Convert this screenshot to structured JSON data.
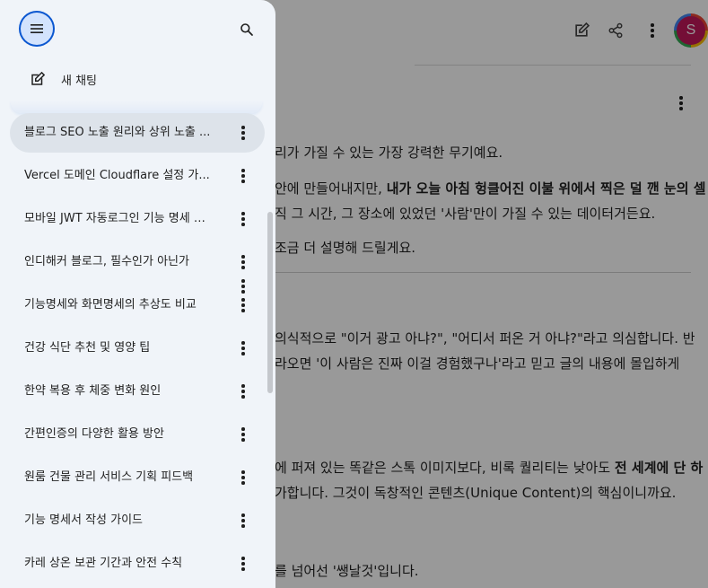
{
  "drawer": {
    "new_chat_label": "새 채팅",
    "chats": [
      {
        "title": "블로그 SEO 노출 원리와 상위 노출 ...",
        "active": true
      },
      {
        "title": "Vercel 도메인 Cloudflare 설정 가..."
      },
      {
        "title": "모바일 JWT 자동로그인 기능 명세 작..."
      },
      {
        "title": "인디해커 블로그, 필수인가 아닌가"
      },
      {
        "title": "기능명세와 화면명세의 추상도 비교"
      },
      {
        "title": "건강 식단 추천 및 영양 팁"
      },
      {
        "title": "한약 복용 후 체중 변화 원인"
      },
      {
        "title": "간편인증의 다양한 활용 방안"
      },
      {
        "title": "원룸 건물 관리 서비스 기획 피드백"
      },
      {
        "title": "기능 명세서 작성 가이드"
      },
      {
        "title": "카레 상온 보관 기간과 안전 수칙"
      }
    ]
  },
  "header": {
    "avatar_initial": "S"
  },
  "conversation": {
    "line1": "리가 가질 수 있는 가장 강력한 무기예요.",
    "line2_normal": "안에 만들어내지만, ",
    "line2_bold": "내가 오늘 아침 헝클어진 이불 위에서 찍은 덜 깬 눈의 셀",
    "line3": "직 그 시간, 그 장소에 있었던 '사람'만이 가질 수 있는 데이터거든요.",
    "line4": " 조금 더 설명해 드릴게요.",
    "line5": "의식적으로 \"이거 광고 아냐?\", \"어디서 퍼온 거 아냐?\"라고 의심합니다. 반",
    "line6": "라오면 '이 사람은 진짜 이걸 경험했구나'라고 믿고 글의 내용에 몰입하게",
    "line7_normal": "에 퍼져 있는 똑같은 스톡 이미지보다, 비록 퀄리티는 낮아도 ",
    "line7_bold": "전 세계에 단 하",
    "line8": "가합니다. 그것이 독창적인 콘텐츠(Unique Content)의 핵심이니까요.",
    "line9": "를 넘어선 '쌩날것'입니다."
  },
  "icons": {
    "menu": "menu-icon",
    "search": "search-icon",
    "new_chat": "edit-icon",
    "more": "more-vert-icon",
    "share": "share-icon"
  }
}
